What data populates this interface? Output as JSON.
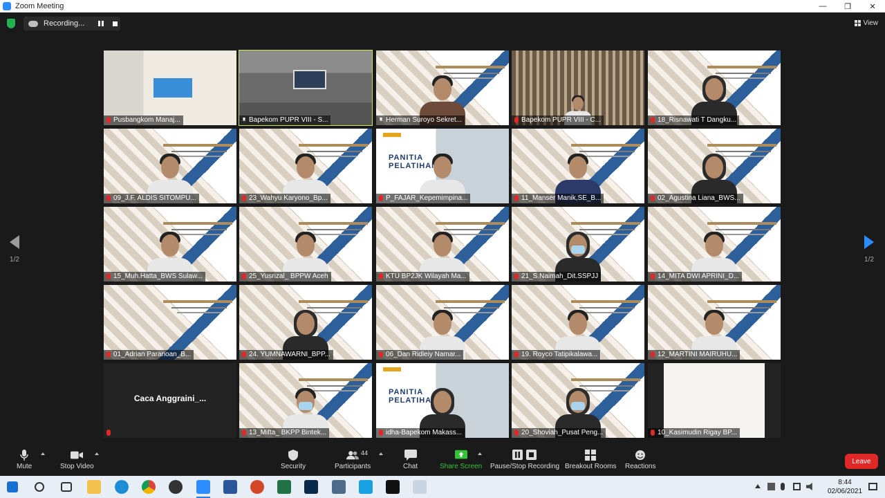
{
  "window": {
    "title": "Zoom Meeting",
    "minimize": "—",
    "maximize": "❐",
    "close": "✕"
  },
  "recording": {
    "label": "Recording..."
  },
  "view": {
    "label": "View"
  },
  "pages": {
    "left": "1/2",
    "right": "1/2"
  },
  "tiles": [
    {
      "name": "Pusbangkom Manaj...",
      "kind": "office",
      "mic": "muted"
    },
    {
      "name": "Bapekom PUPR VIII - S...",
      "kind": "conf",
      "mic": "pin",
      "active": true
    },
    {
      "name": "Herman Suroyo Sekret...",
      "kind": "slide-batik",
      "mic": "pin"
    },
    {
      "name": "Bapekom PUPR VIII - C...",
      "kind": "library",
      "mic": "muted"
    },
    {
      "name": "18_Risnawati T Dangku...",
      "kind": "slide-hijab",
      "mic": "muted"
    },
    {
      "name": "09_J.F. ALDIS SITOMPU...",
      "kind": "slide-person",
      "mic": "muted"
    },
    {
      "name": "23_Wahyu Karyono_Bp...",
      "kind": "slide-person",
      "mic": "muted"
    },
    {
      "name": "P_FAJAR_Kepemimpina...",
      "kind": "panitia",
      "mic": "muted"
    },
    {
      "name": "11_Manser Manik,SE_B...",
      "kind": "slide-blue",
      "mic": "muted"
    },
    {
      "name": "02_Agustina Liana_BWS...",
      "kind": "slide-hijab",
      "mic": "muted"
    },
    {
      "name": "15_Muh.Hatta_BWS Sulaw...",
      "kind": "slide-person",
      "mic": "muted"
    },
    {
      "name": "25_Yusrizal_ BPPW Aceh",
      "kind": "slide-person",
      "mic": "muted"
    },
    {
      "name": "KTU BP2JK Wilayah Ma...",
      "kind": "slide-person",
      "mic": "muted"
    },
    {
      "name": "21_S.Naimah_Dit.SSPJJ",
      "kind": "slide-mask-hijab",
      "mic": "muted"
    },
    {
      "name": "14_MITA DWI APRINI_D...",
      "kind": "slide-person",
      "mic": "muted"
    },
    {
      "name": "01_Adrian Paranoan_B...",
      "kind": "slide",
      "mic": "muted"
    },
    {
      "name": "24. YUMNAWARNI_BPP...",
      "kind": "slide-hijab",
      "mic": "muted"
    },
    {
      "name": "06_Dan Ridleiy Namar...",
      "kind": "slide-person",
      "mic": "muted"
    },
    {
      "name": "19. Royco Tatipikalawa...",
      "kind": "slide-person",
      "mic": "muted"
    },
    {
      "name": "12_MARTINI MAIRUHU...",
      "kind": "slide-person",
      "mic": "muted"
    },
    {
      "name": "Caca  Anggraini_...",
      "kind": "dark",
      "mic": "muted",
      "centered": "Caca  Anggraini_..."
    },
    {
      "name": "13_Mifta_ BKPP Bintek...",
      "kind": "slide-mask",
      "mic": "muted"
    },
    {
      "name": "idha-Bapekom Makass...",
      "kind": "panitia-hijab",
      "mic": "muted"
    },
    {
      "name": "20_Shoviah_Pusat Peng...",
      "kind": "slide-mask-hijab",
      "mic": "muted"
    },
    {
      "name": "10_Kasimudin Rigay BP...",
      "kind": "doc",
      "mic": "muted"
    }
  ],
  "panitia_text": "PANITIA\nPELATIHAN",
  "toolbar": {
    "mute": "Mute",
    "stop_video": "Stop Video",
    "security": "Security",
    "participants": "Participants",
    "participants_count": "44",
    "chat": "Chat",
    "share_screen": "Share Screen",
    "pause_recording": "Pause/Stop Recording",
    "breakout": "Breakout Rooms",
    "reactions": "Reactions",
    "leave": "Leave"
  },
  "taskbar": {
    "time": "8:44",
    "date": "02/06/2021"
  },
  "colors": {
    "accent": "#2d8cff",
    "leave": "#e02828",
    "share": "#35c23a",
    "active_speaker": "#c6e85a"
  }
}
